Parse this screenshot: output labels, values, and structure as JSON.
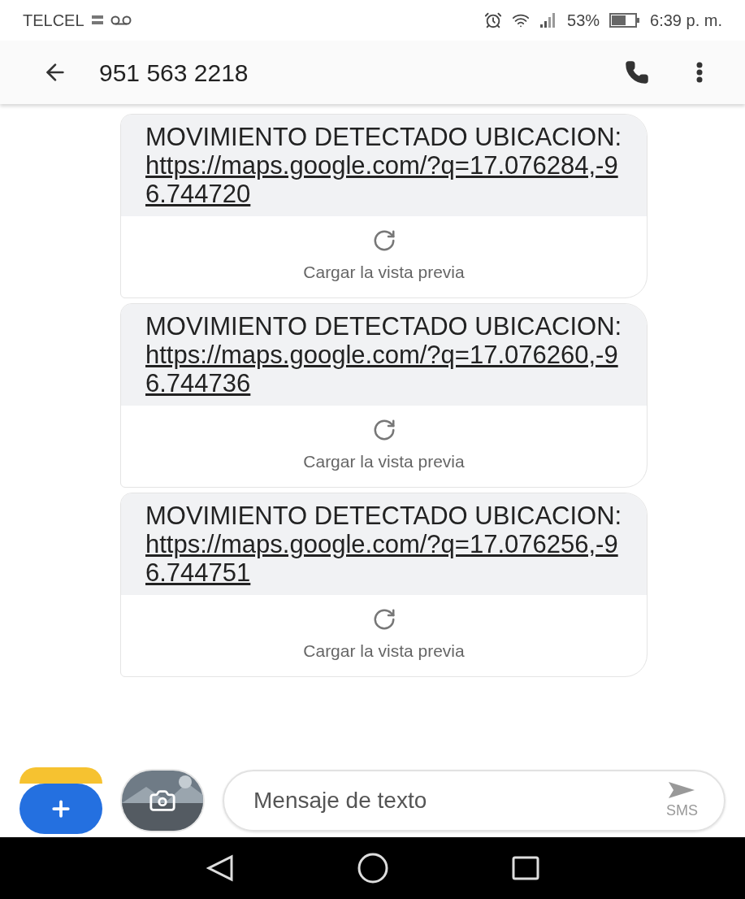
{
  "status_bar": {
    "carrier": "TELCEL",
    "battery": "53%",
    "time": "6:39 p. m."
  },
  "header": {
    "title": "951 563 2218"
  },
  "messages": [
    {
      "text": "MOVIMIENTO DETECTADO UBICACION: ",
      "link": "https://maps.google.com/?q=17.076284,-96.744720",
      "preview_label": "Cargar la vista previa"
    },
    {
      "text": "MOVIMIENTO DETECTADO UBICACION: ",
      "link": "https://maps.google.com/?q=17.076260,-96.744736",
      "preview_label": "Cargar la vista previa"
    },
    {
      "text": "MOVIMIENTO DETECTADO UBICACION: ",
      "link": "https://maps.google.com/?q=17.076256,-96.744751",
      "preview_label": "Cargar la vista previa"
    }
  ],
  "composer": {
    "placeholder": "Mensaje de texto",
    "send_label": "SMS"
  }
}
